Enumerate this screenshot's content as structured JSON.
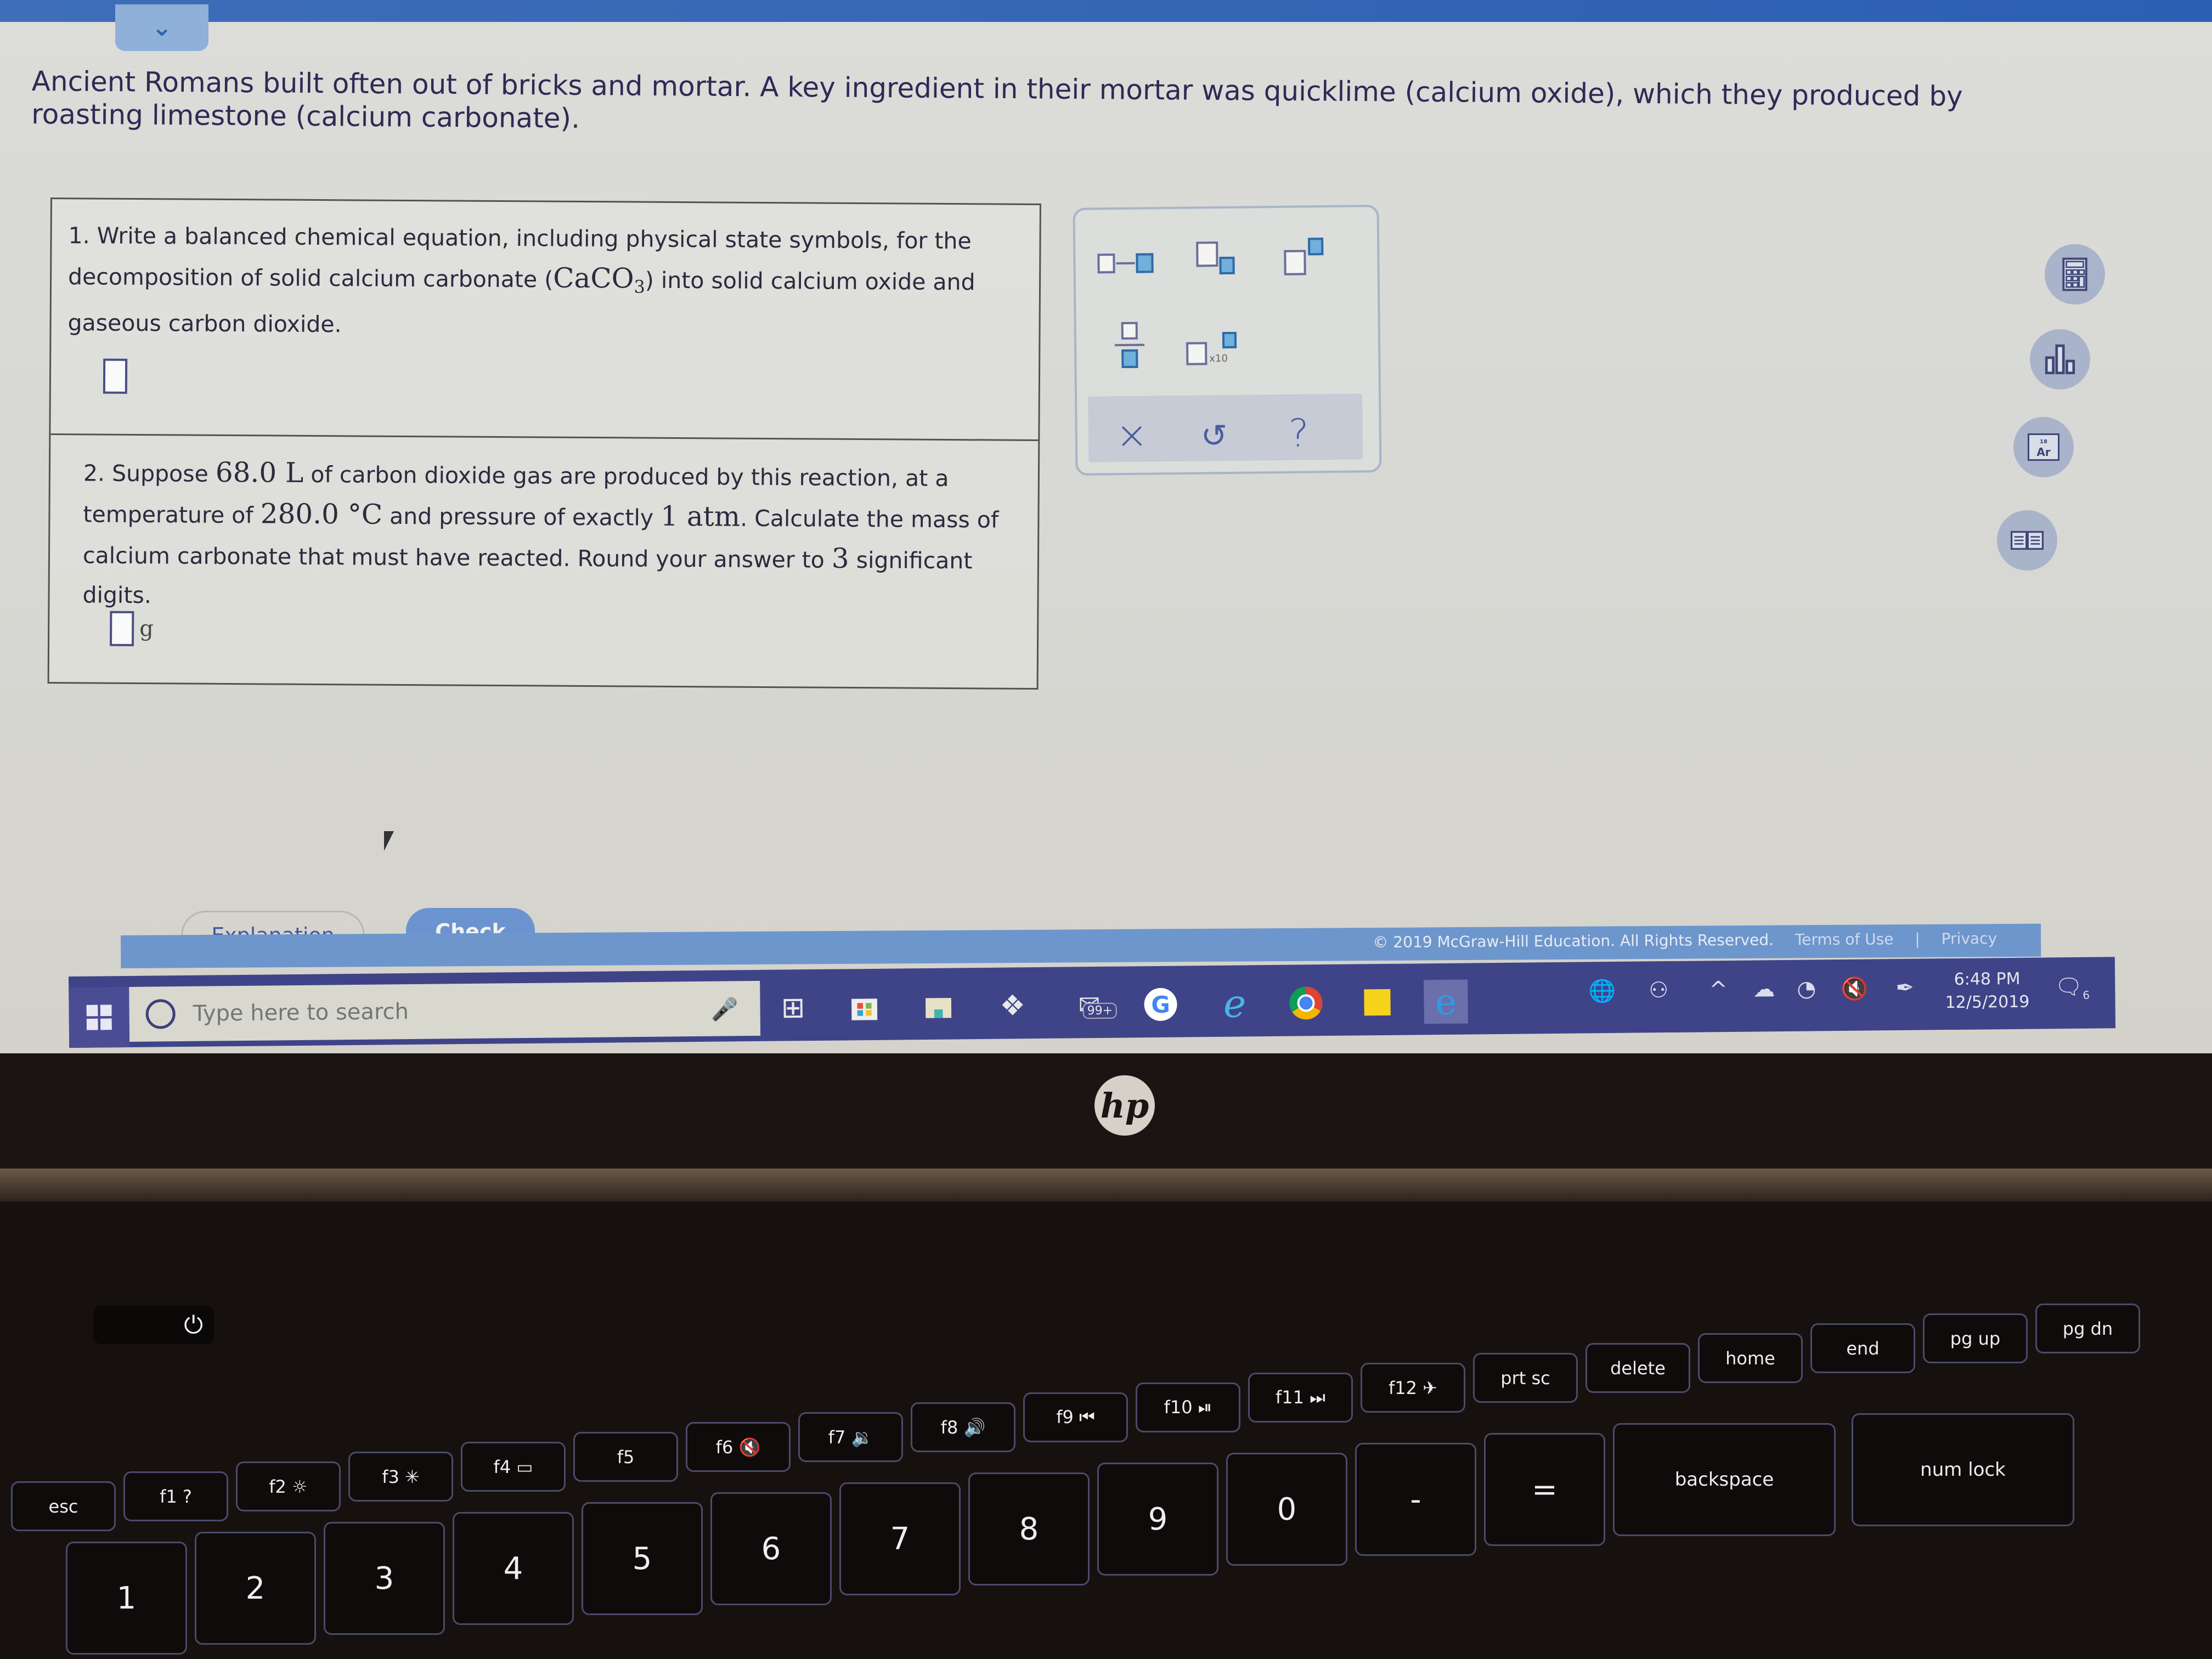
{
  "header": {
    "collapse_icon": "chevron-down-icon",
    "collapse_glyph": "⌄"
  },
  "intro": {
    "text": "Ancient Romans built often out of bricks and mortar. A key ingredient in their mortar was quicklime (calcium oxide), which they produced by roasting limestone (calcium carbonate)."
  },
  "question1": {
    "text_before": "1. Write a balanced chemical equation, including physical state symbols, for the decomposition of solid calcium carbonate (",
    "formula_main": "CaCO",
    "formula_sub": "3",
    "text_after": ") into solid calcium oxide and gaseous carbon dioxide.",
    "answer_value": ""
  },
  "question2": {
    "text_1": "2. Suppose ",
    "volume": "68.0 L",
    "text_2": " of carbon dioxide gas are produced by this reaction, at a temperature of ",
    "temperature": "280.0 °C",
    "text_3": " and pressure of exactly ",
    "pressure": "1 atm",
    "text_4": ". Calculate the mass of calcium carbonate that must have reacted. Round your answer to ",
    "sig_figs": "3",
    "text_5": " significant digits.",
    "answer_value": "",
    "unit": "g"
  },
  "palette": {
    "buttons": [
      "reaction-arrow",
      "subscript",
      "superscript",
      "fraction",
      "scientific-notation"
    ],
    "sci_label": "x10",
    "actions": {
      "clear": "×",
      "undo": "↺",
      "help": "?"
    }
  },
  "tools": [
    "calculator-icon",
    "data-chart-icon",
    "periodic-table-icon",
    "textbook-icon"
  ],
  "tool_labels": {
    "periodic": "Ar",
    "periodic_num": "18"
  },
  "buttons": {
    "explanation": "Explanation",
    "check": "Check"
  },
  "footer": {
    "copyright": "© 2019 McGraw-Hill Education. All Rights Reserved.",
    "terms": "Terms of Use",
    "separator": "|",
    "privacy": "Privacy"
  },
  "taskbar": {
    "search_placeholder": "Type here to search",
    "mail_badge": "99+",
    "time": "6:48 PM",
    "date": "12/5/2019",
    "notification_count": "6",
    "apps": [
      "task-view",
      "microsoft-store",
      "file-explorer",
      "dropbox",
      "mail",
      "google",
      "internet-explorer",
      "chrome",
      "sticky-notes",
      "edge"
    ]
  },
  "laptop": {
    "brand": "hp",
    "keys_fn": [
      "esc",
      "f1 ?",
      "f2 ☼",
      "f3 ✳",
      "f4 ▭",
      "f5",
      "f6 🔇",
      "f7 🔉",
      "f8 🔊",
      "f9 ⏮",
      "f10 ⏯",
      "f11 ⏭",
      "f12 ✈",
      "prt sc",
      "delete",
      "home",
      "end",
      "pg up",
      "pg dn"
    ],
    "keys_num": [
      "1",
      "2",
      "3",
      "4",
      "5",
      "6",
      "7",
      "8",
      "9",
      "0",
      "-",
      "=",
      "backspace",
      "num lock"
    ]
  },
  "colors": {
    "accent": "#6b93cf",
    "top_bar": "#2b5fb3",
    "taskbar": "#3f4488",
    "text": "#2e2a55"
  }
}
